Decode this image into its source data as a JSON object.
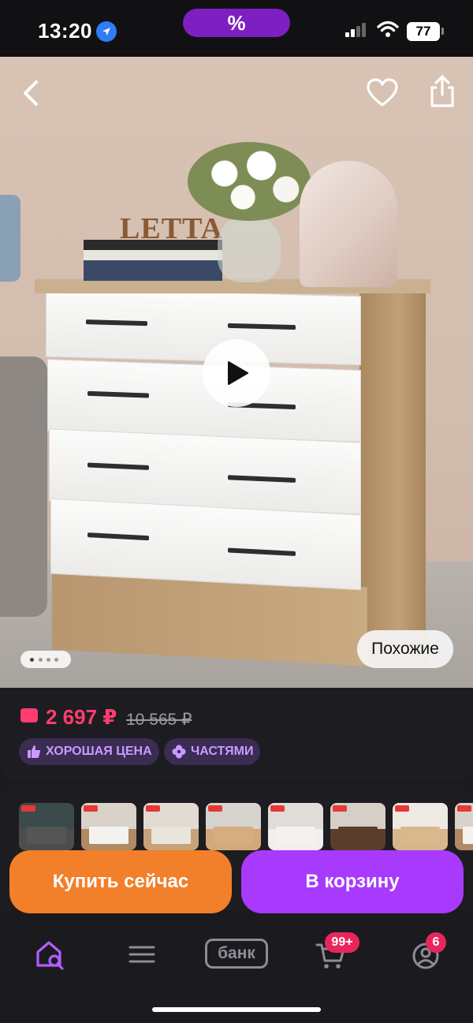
{
  "status_bar": {
    "time": "13:20",
    "promo_symbol": "%",
    "battery": "77"
  },
  "product": {
    "brand_text": "LETTA",
    "similar_label": "Похожие",
    "gallery_total": 4,
    "gallery_active": 1
  },
  "price": {
    "current": "2 697 ₽",
    "old": "10 565 ₽",
    "badges": [
      {
        "label": "ХОРОШАЯ ЦЕНА",
        "icon": "thumbs-up-icon"
      },
      {
        "label": "ЧАСТЯМИ",
        "icon": "clover-icon"
      }
    ]
  },
  "actions": {
    "buy_now": "Купить сейчас",
    "add_to_cart": "В корзину"
  },
  "tabbar": {
    "items": [
      {
        "name": "home-search",
        "icon": "home-search-icon",
        "active": true
      },
      {
        "name": "catalog",
        "icon": "menu-icon"
      },
      {
        "name": "bank",
        "label": "банк"
      },
      {
        "name": "cart",
        "icon": "cart-icon",
        "badge": "99+"
      },
      {
        "name": "profile",
        "icon": "profile-icon",
        "badge": "6"
      }
    ]
  },
  "colors": {
    "accent_purple": "#a73afd",
    "accent_orange": "#f27f29",
    "price_pink": "#ff3d6e"
  }
}
